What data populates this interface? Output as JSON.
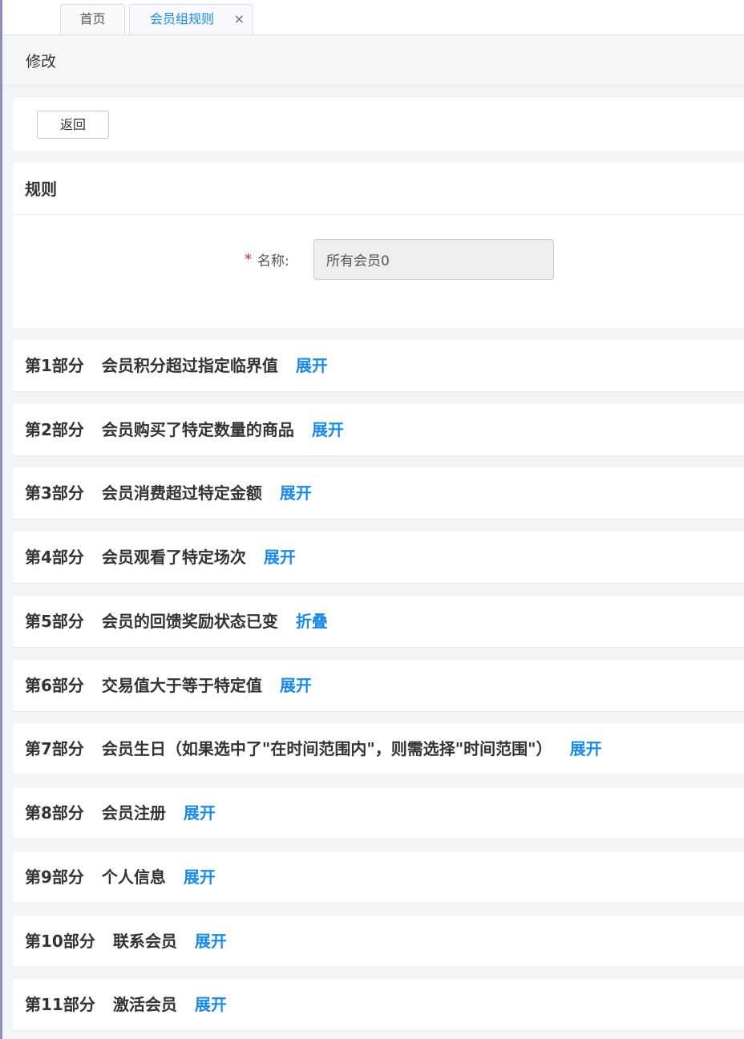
{
  "tabs": [
    {
      "label": "首页"
    },
    {
      "label": "会员组规则",
      "close": "×"
    }
  ],
  "page": {
    "title": "修改"
  },
  "toolbar": {
    "back_label": "返回"
  },
  "rule": {
    "title": "规则",
    "required_mark": "*",
    "name_label": "名称:",
    "name_value": "所有会员0"
  },
  "sections": [
    {
      "number": "第1部分",
      "title": "会员积分超过指定临界值",
      "toggle": "展开"
    },
    {
      "number": "第2部分",
      "title": "会员购买了特定数量的商品",
      "toggle": "展开"
    },
    {
      "number": "第3部分",
      "title": "会员消费超过特定金额",
      "toggle": "展开"
    },
    {
      "number": "第4部分",
      "title": "会员观看了特定场次",
      "toggle": "展开"
    },
    {
      "number": "第5部分",
      "title": "会员的回馈奖励状态已变",
      "toggle": "折叠"
    },
    {
      "number": "第6部分",
      "title": "交易值大于等于特定值",
      "toggle": "展开"
    },
    {
      "number": "第7部分",
      "title": "会员生日（如果选中了\"在时间范围内\"，则需选择\"时间范围\"）",
      "toggle": "展开"
    },
    {
      "number": "第8部分",
      "title": "会员注册",
      "toggle": "展开"
    },
    {
      "number": "第9部分",
      "title": "个人信息",
      "toggle": "展开"
    },
    {
      "number": "第10部分",
      "title": "联系会员",
      "toggle": "展开"
    },
    {
      "number": "第11部分",
      "title": "激活会员",
      "toggle": "展开"
    }
  ],
  "colors": {
    "accent": "#1a8ae6",
    "required": "#e02020",
    "background": "#f3f4f6"
  }
}
